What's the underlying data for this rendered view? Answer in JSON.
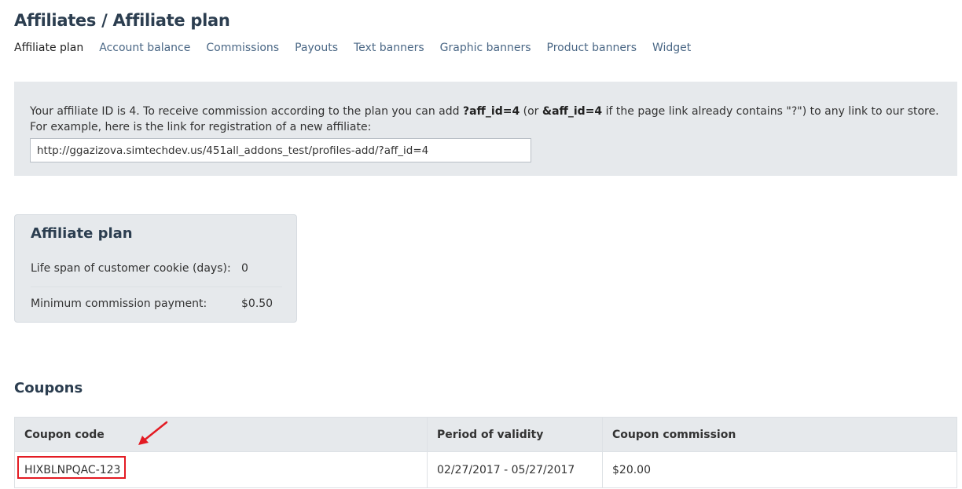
{
  "page": {
    "title": "Affiliates / Affiliate plan"
  },
  "tabs": [
    {
      "label": "Affiliate plan",
      "active": true
    },
    {
      "label": "Account balance"
    },
    {
      "label": "Commissions"
    },
    {
      "label": "Payouts"
    },
    {
      "label": "Text banners"
    },
    {
      "label": "Graphic banners"
    },
    {
      "label": "Product banners"
    },
    {
      "label": "Widget"
    }
  ],
  "notice": {
    "text_1": "Your affiliate ID is 4. To receive commission according to the plan you can add ",
    "param_1": "?aff_id=4",
    "text_2": " (or ",
    "param_2": "&aff_id=4",
    "text_3": " if the page link already contains \"?\") to any link to our store. For example, here is the link for registration of a new affiliate:",
    "link_value": "http://ggazizova.simtechdev.us/451all_addons_test/profiles-add/?aff_id=4"
  },
  "plan": {
    "title": "Affiliate plan",
    "rows": [
      {
        "label": "Life span of customer cookie (days):",
        "value": "0"
      },
      {
        "label": "Minimum commission payment:",
        "value": "$0.50"
      }
    ]
  },
  "coupons": {
    "title": "Coupons",
    "columns": [
      "Coupon code",
      "Period of validity",
      "Coupon commission"
    ],
    "rows": [
      {
        "code": "HIXBLNPQAC-123",
        "period": "02/27/2017 - 05/27/2017",
        "commission": "$20.00"
      }
    ]
  },
  "annotation": {
    "color": "#e31b23"
  }
}
